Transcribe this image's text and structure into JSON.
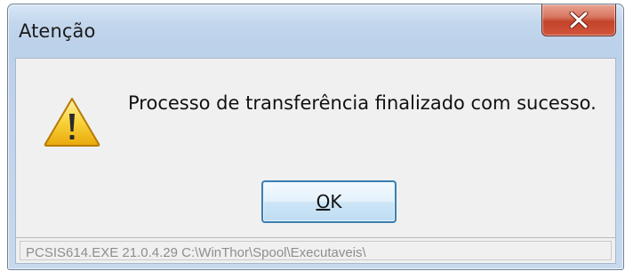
{
  "window": {
    "title": "Atenção",
    "close_icon": "close-x-icon",
    "close_color": "#c4432a"
  },
  "dialog": {
    "icon": "warning-icon",
    "icon_color": "#f4c21b",
    "message": "Processo de transferência finalizado com sucesso.",
    "ok_label": "OK"
  },
  "statusbar": {
    "text": "PCSIS614.EXE 21.0.4.29 C:\\WinThor\\Spool\\Executaveis\\"
  }
}
